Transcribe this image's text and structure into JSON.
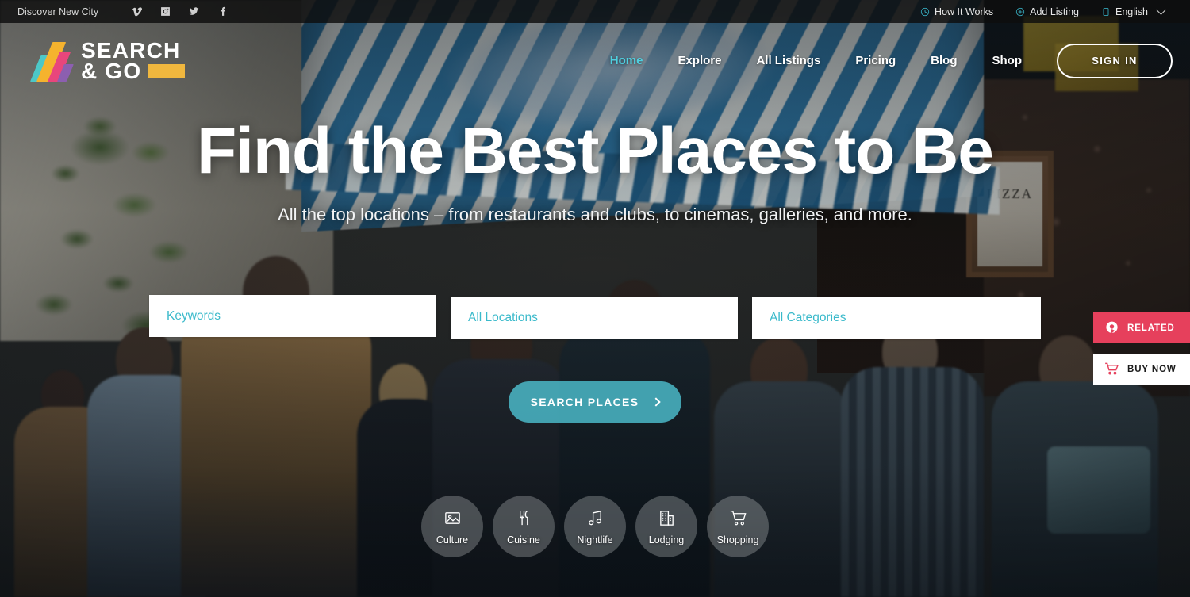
{
  "topbar": {
    "tagline": "Discover New City",
    "social": [
      {
        "name": "vimeo-icon",
        "label": "Vimeo"
      },
      {
        "name": "instagram-icon",
        "label": "Instagram"
      },
      {
        "name": "twitter-icon",
        "label": "Twitter"
      },
      {
        "name": "facebook-icon",
        "label": "Facebook"
      }
    ],
    "how_it_works": "How It Works",
    "add_listing": "Add Listing",
    "language": "English",
    "accent": "#3bbfd4"
  },
  "header": {
    "logo": {
      "line1": "SEARCH",
      "line2": "& GO"
    },
    "nav": [
      {
        "label": "Home",
        "active": true
      },
      {
        "label": "Explore",
        "active": false
      },
      {
        "label": "All Listings",
        "active": false
      },
      {
        "label": "Pricing",
        "active": false
      },
      {
        "label": "Blog",
        "active": false
      },
      {
        "label": "Shop",
        "active": false
      }
    ],
    "signin_label": "SIGN IN",
    "active_color": "#4fd0e0"
  },
  "hero": {
    "title": "Find the Best Places to Be",
    "subtitle": "All the top locations – from restaurants and clubs, to cinemas, galleries, and more.",
    "search": {
      "keywords_placeholder": "Keywords",
      "location_placeholder": "All Locations",
      "category_placeholder": "All Categories",
      "button_label": "SEARCH PLACES",
      "placeholder_color": "#3bbacb",
      "button_color": "#4dbece"
    },
    "categories": [
      {
        "label": "Culture",
        "icon": "image-icon"
      },
      {
        "label": "Cuisine",
        "icon": "cutlery-icon"
      },
      {
        "label": "Nightlife",
        "icon": "music-note-icon"
      },
      {
        "label": "Lodging",
        "icon": "building-icon"
      },
      {
        "label": "Shopping",
        "icon": "shopping-cart-icon"
      }
    ]
  },
  "side_widgets": [
    {
      "label": "RELATED",
      "icon": "related-pin-icon",
      "bg": "#e6405c",
      "fg": "#ffffff"
    },
    {
      "label": "BUY NOW",
      "icon": "shopping-cart-icon",
      "bg": "#ffffff",
      "fg": "#1b1b1b"
    }
  ],
  "background": {
    "poster_text": "PIZZA"
  }
}
